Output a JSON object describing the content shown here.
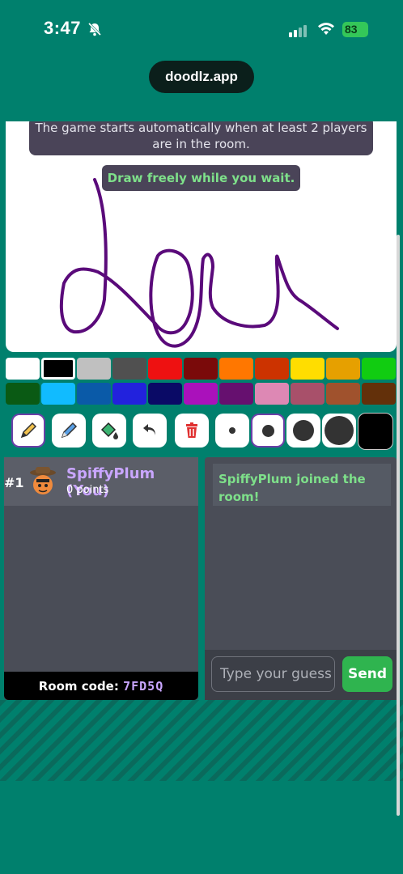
{
  "status_bar": {
    "time": "3:47",
    "battery": "83"
  },
  "browser": {
    "url": "doodlz.app"
  },
  "canvas": {
    "notice": "The game starts automatically when at least 2 players are in the room.",
    "draw_hint": "Draw freely while you wait.",
    "stroke_color": "#5a0a7a"
  },
  "palette": {
    "colors_row1": [
      "#ffffff",
      "#000000",
      "#c0c0c0",
      "#505050",
      "#ee1111",
      "#7a0a0a",
      "#ff7700",
      "#cc3300",
      "#ffdd00",
      "#e6a000",
      "#11cc11"
    ],
    "colors_row2": [
      "#0a5a14",
      "#11bbff",
      "#0a5aa8",
      "#2222dd",
      "#0a0a66",
      "#aa11bb",
      "#66106f",
      "#dd88b4",
      "#a8506a",
      "#a0522d",
      "#63300a"
    ],
    "selected_color": "#000000"
  },
  "tools": {
    "items": [
      "pencil-icon",
      "eraser-icon",
      "fill-bucket-icon",
      "undo-icon",
      "trash-icon"
    ],
    "selected_tool": "pencil",
    "brush_sizes": [
      "small",
      "medium",
      "large",
      "xlarge"
    ],
    "selected_size": "medium",
    "current_color": "#000000"
  },
  "players": {
    "list": [
      {
        "rank": "#1",
        "name": "SpiffyPlum (You)",
        "points": "0 points"
      }
    ],
    "room_code_label": "Room code:",
    "room_code": "7FD5Q"
  },
  "chat": {
    "messages": [
      "SpiffyPlum joined the room!"
    ],
    "input_placeholder": "Type your guess here...",
    "send_label": "Send"
  }
}
